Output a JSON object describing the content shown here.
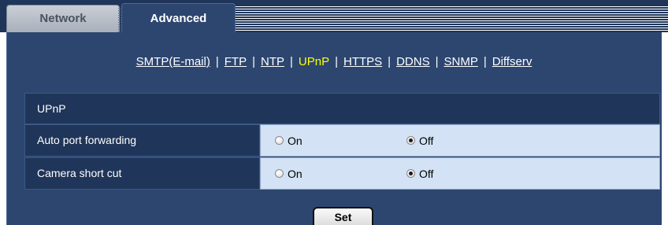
{
  "tabs": {
    "network": "Network",
    "advanced": "Advanced"
  },
  "subnav": {
    "items": [
      "SMTP(E-mail)",
      "FTP",
      "NTP",
      "UPnP",
      "HTTPS",
      "DDNS",
      "SNMP",
      "Diffserv"
    ],
    "active": "UPnP",
    "separator": "|"
  },
  "section": {
    "title": "UPnP"
  },
  "rows": [
    {
      "label": "Auto port forwarding",
      "on_label": "On",
      "off_label": "Off",
      "selected": "Off"
    },
    {
      "label": "Camera short cut",
      "on_label": "On",
      "off_label": "Off",
      "selected": "Off"
    }
  ],
  "set_button": {
    "label": "Set"
  },
  "colors": {
    "tab_bar": "#1f3559",
    "panel": "#2c466f",
    "value_cell": "#d3e2f4",
    "active_link": "#ffff00"
  }
}
